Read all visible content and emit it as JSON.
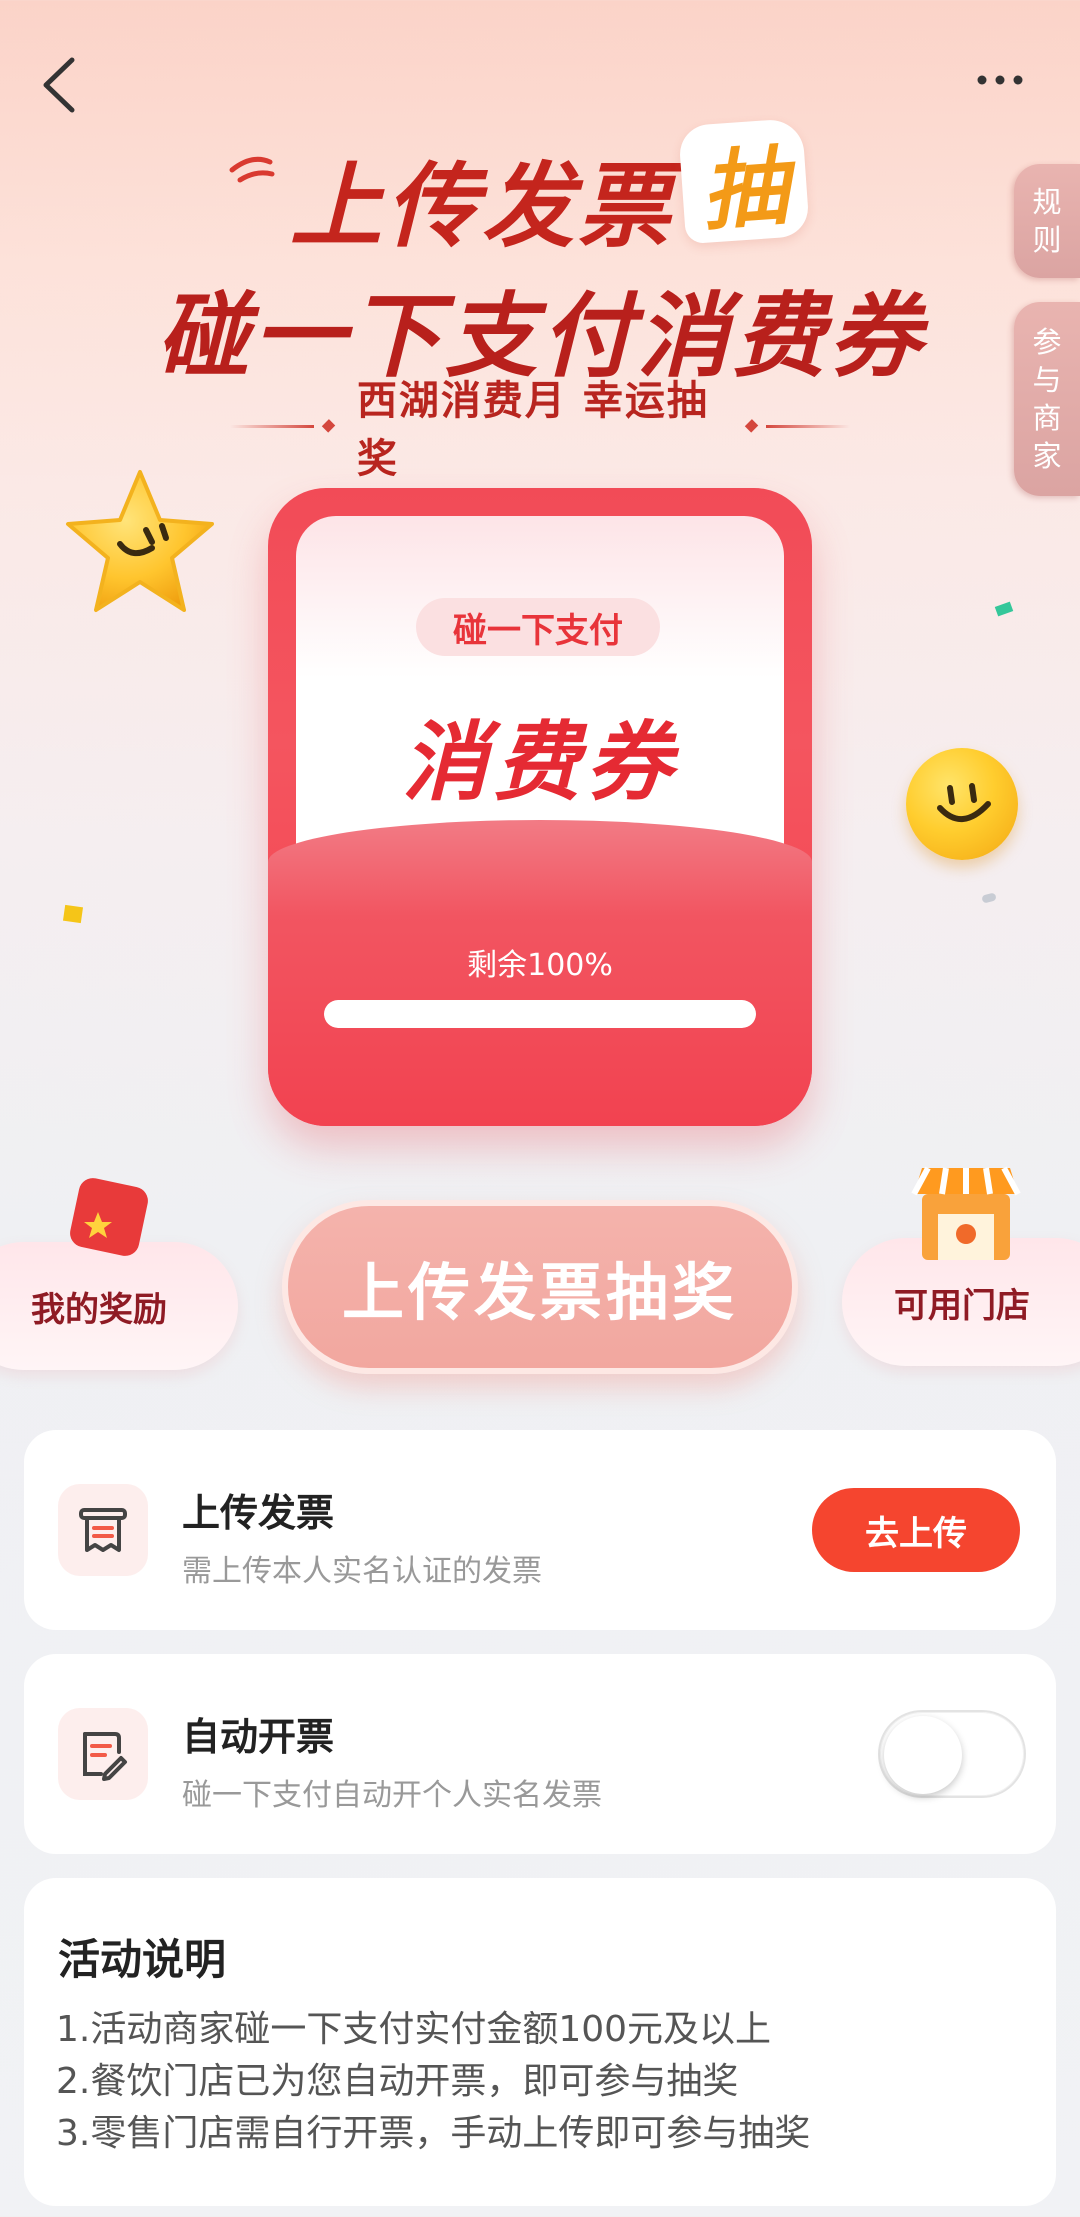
{
  "header": {
    "back_icon": "chevron-left-icon",
    "more_icon": "more-dots-icon"
  },
  "side_tabs": {
    "rules": "规则",
    "merchants": "参与商家"
  },
  "headline": {
    "line1": "上传发票",
    "badge": "抽",
    "line2": "碰一下支付消费券",
    "subtitle": "西湖消费月 幸运抽奖"
  },
  "voucher": {
    "tag": "碰一下支付",
    "title": "消费券",
    "remaining_text": "剩余100%",
    "remaining_fraction": 1.0
  },
  "actions": {
    "my_rewards": "我的奖励",
    "upload_draw": "上传发票抽奖",
    "available_stores": "可用门店"
  },
  "tasks": [
    {
      "icon": "invoice-icon",
      "title": "上传发票",
      "subtitle": "需上传本人实名认证的发票",
      "button": "去上传"
    },
    {
      "icon": "document-edit-icon",
      "title": "自动开票",
      "subtitle": "碰一下支付自动开个人实名发票",
      "toggle_on": false
    }
  ],
  "description": {
    "title": "活动说明",
    "items": [
      "1.活动商家碰一下支付实付金额100元及以上",
      "2.餐饮门店已为您自动开票，即可参与抽奖",
      "3.零售门店需自行开票，手动上传即可参与抽奖"
    ]
  },
  "colors": {
    "accent_red": "#f5452f",
    "voucher_red": "#f24b57",
    "title_red": "#c4251d",
    "badge_orange": "#f39a17"
  }
}
